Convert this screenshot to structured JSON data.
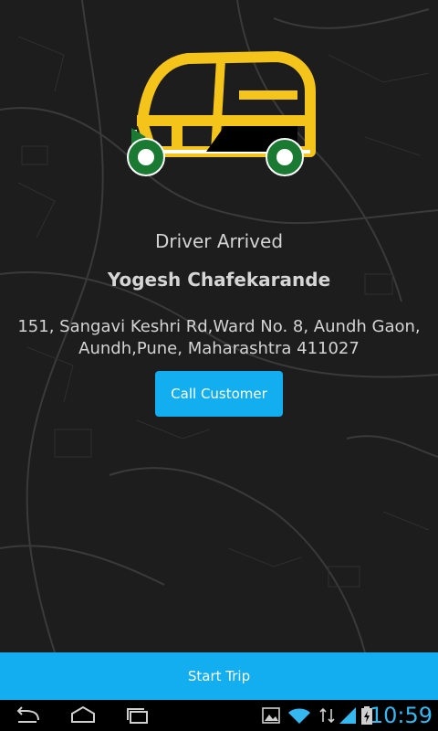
{
  "screen": {
    "status_title": "Driver Arrived",
    "driver_name": "Yogesh Chafekarande",
    "address": "151, Sangavi Keshri Rd,Ward No. 8, Aundh Gaon, Aundh,Pune, Maharashtra 411027",
    "call_button": "Call Customer",
    "start_button": "Start Trip"
  },
  "system_bar": {
    "time": "10:59",
    "icons": [
      "back-icon",
      "home-icon",
      "recent-apps-icon",
      "gallery-icon",
      "wifi-icon",
      "signal-icon",
      "battery-charging-icon"
    ]
  },
  "colors": {
    "accent": "#13aef0",
    "logo_yellow": "#f5c41b",
    "logo_green": "#1a7a32",
    "background": "#1d1d1d"
  }
}
